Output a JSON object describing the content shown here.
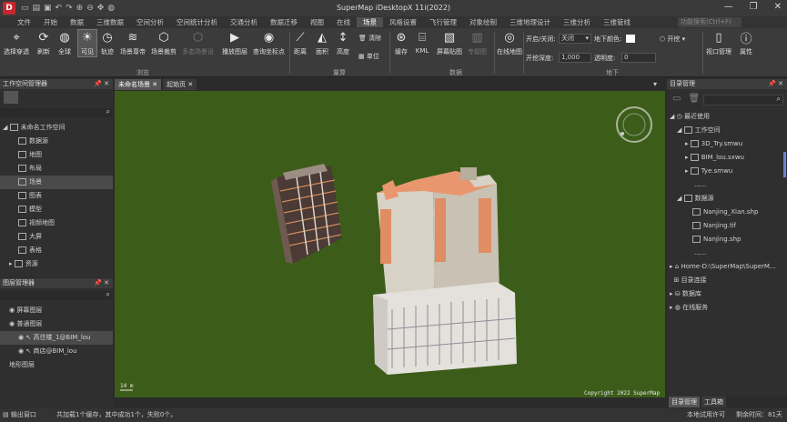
{
  "app": {
    "title": "SuperMap iDesktopX 11i(2022)",
    "logo_text": "D"
  },
  "menubar": {
    "items": [
      "文件",
      "开始",
      "数据",
      "三维数据",
      "空间分析",
      "空间统计分析",
      "交通分析",
      "数据迁移",
      "视图",
      "在线",
      "场景",
      "风格设置",
      "飞行管理",
      "对象绘制",
      "三维地理设计",
      "三维分析",
      "三维管线"
    ],
    "search_placeholder": "功能搜索(Ctrl+F)"
  },
  "ribbon": {
    "buttons": {
      "select_penetrate": "选择穿透",
      "refresh": "刷新",
      "full": "全球",
      "visible": "可见",
      "track": "轨迹",
      "scene_browse": "场景尊帝",
      "scene_snapshot": "场景裁剪",
      "multi_scene": "多态场景设",
      "play_layer": "播放图层",
      "query_coords": "查询坐标点",
      "distance": "距离",
      "area": "面积",
      "height": "高度",
      "clear": "清除",
      "unit": "单位",
      "cache": "缓存",
      "kml": "KML",
      "screen_snap": "屏幕贴图",
      "special": "专题图",
      "online_map": "在线地图",
      "viewport": "视口管理",
      "props": "属性"
    },
    "groups": {
      "browse": "浏览",
      "measure": "量算",
      "data": "数据",
      "underground": "地下"
    },
    "underground": {
      "open_close_label": "开启/关闭:",
      "open_close_value": "关闭",
      "color_label": "地下颜色:",
      "depth_label": "开挖深度:",
      "depth_value": "1,000",
      "opacity_label": "透明度:",
      "opacity_value": "0",
      "on_label": "开挖"
    }
  },
  "workspace_manager": {
    "title": "工作空间管理器",
    "items": [
      "未命名工作空间",
      "数据源",
      "地图",
      "布局",
      "场景",
      "图表",
      "模型",
      "视频地图",
      "大屏",
      "表格",
      "资源"
    ]
  },
  "layer_manager": {
    "title": "图层管理器",
    "items": [
      "屏幕图层",
      "普通图层",
      "高住楼_1@BIM_lou",
      "商店@BIM_lou",
      "地形图层"
    ]
  },
  "doc_tabs": [
    "未命名场景",
    "起始页"
  ],
  "scene": {
    "scale_text": "14 m",
    "copyright": "Copyright 2022 SuperMap"
  },
  "directory_manager": {
    "title": "目录管理",
    "items": [
      "最近使用",
      "工作空间",
      "3D_Try.smwu",
      "BIM_lou.sxwu",
      "Tye.smwu",
      "......",
      "数据源",
      "Nanjing_Xian.shp",
      "Nanjing.tif",
      "Nanjing.shp",
      "......",
      "Home-D:\\SuperMap\\SuperM...",
      "目录连接",
      "数据库",
      "在线服务"
    ]
  },
  "bottom_tabs": [
    "目录管理",
    "工具箱"
  ],
  "status": {
    "output": "输出窗口",
    "message": "共加载1个缓存，其中成功1个，失败0个。",
    "license": "本地试用许可",
    "days": "剩余时间：81天"
  }
}
